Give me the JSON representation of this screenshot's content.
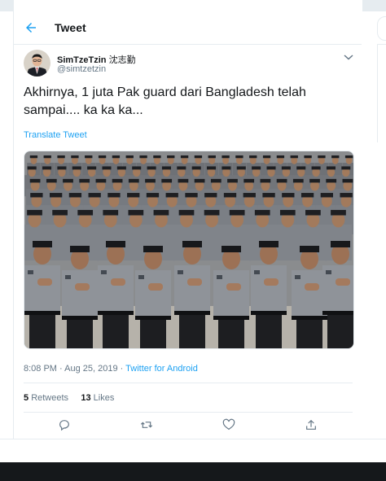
{
  "header": {
    "title": "Tweet",
    "back_icon": "arrow-left-icon"
  },
  "tweet": {
    "display_name": "SimTzeTzin",
    "display_name_cjk": "沈志勤",
    "handle": "@simtzetzin",
    "text": "Akhirnya, 1 juta Pak guard dari Bangladesh telah sampai.... ka ka ka...",
    "translate_label": "Translate Tweet",
    "time": "8:08 PM · Aug 25, 2019 · ",
    "source": "Twitter for Android",
    "retweets_count": "5",
    "retweets_label": "Retweets",
    "likes_count": "13",
    "likes_label": "Likes"
  },
  "actions": [
    "reply-icon",
    "retweet-icon",
    "like-icon",
    "share-icon"
  ],
  "colors": {
    "accent": "#1da1f2",
    "text": "#14171a",
    "secondary": "#657786",
    "border": "#e6ecf0"
  }
}
